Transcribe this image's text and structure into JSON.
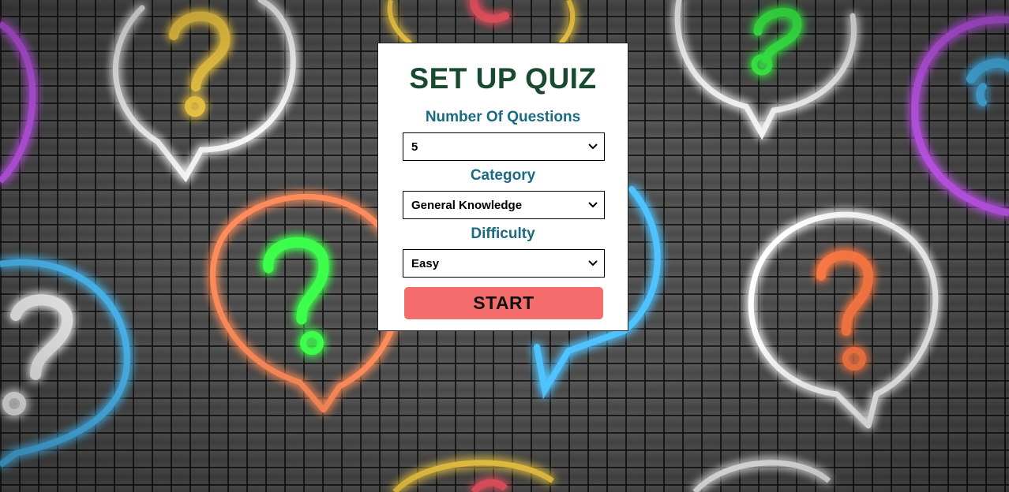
{
  "colors": {
    "title": "#184a2f",
    "label": "#1a6a80",
    "button": "#f56c6c",
    "neon_white": "#ffffff",
    "neon_yellow": "#ffd54a",
    "neon_green": "#3cff4c",
    "neon_orange": "#ff7a45",
    "neon_blue": "#4fc3ff",
    "neon_purple": "#d05cff"
  },
  "form": {
    "title": "SET UP QUIZ",
    "questions_label": "Number Of Questions",
    "questions_value": "5",
    "category_label": "Category",
    "category_value": "General Knowledge",
    "difficulty_label": "Difficulty",
    "difficulty_value": "Easy",
    "start_label": "START"
  },
  "icons": {
    "dropdown": "chevron-down-icon",
    "decor": "neon-question-bubble-icon"
  }
}
